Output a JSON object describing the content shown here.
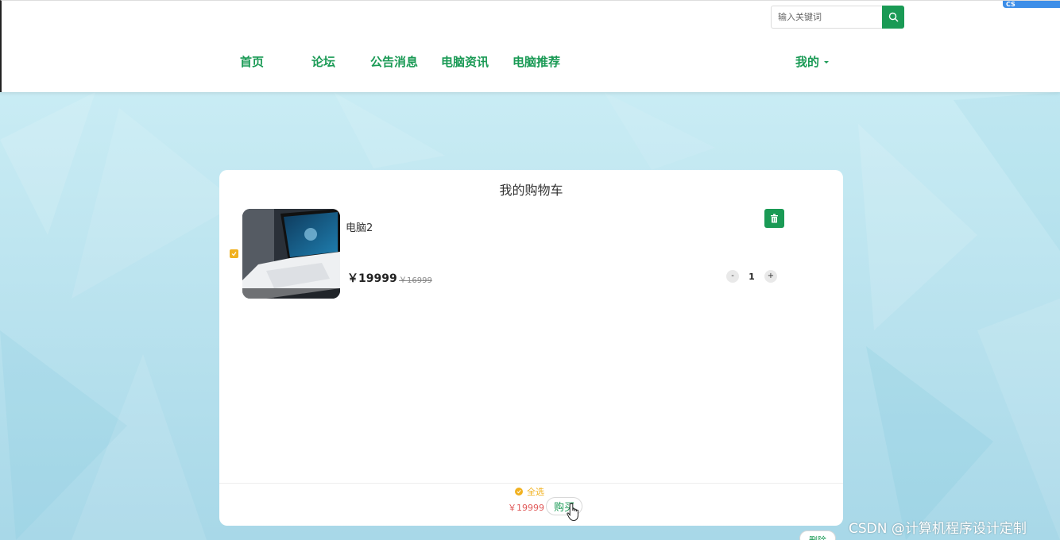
{
  "header": {
    "search_placeholder": "输入关键词",
    "corner_badge": "CS",
    "nav": [
      {
        "label": "首页"
      },
      {
        "label": "论坛"
      },
      {
        "label": "公告消息"
      },
      {
        "label": "电脑资讯"
      },
      {
        "label": "电脑推荐"
      }
    ],
    "user_menu_label": "我的"
  },
  "cart": {
    "title": "我的购物车",
    "items": [
      {
        "name": "电脑2",
        "price": "￥19999",
        "original_price": "￥16999",
        "quantity": "1",
        "decrement_label": "-",
        "increment_label": "+"
      }
    ],
    "select_all_label": "全选",
    "total": "￥19999",
    "buy_label": "购买",
    "delete_label": "删除"
  },
  "watermark": "CSDN @计算机程序设计定制",
  "colors": {
    "accent": "#1a9a55",
    "checkbox": "#f1b11f",
    "total_price": "#e05a5a"
  }
}
